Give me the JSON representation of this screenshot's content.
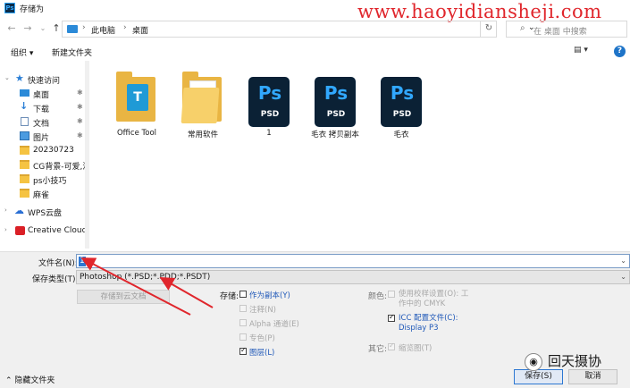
{
  "window": {
    "title": "存储为",
    "app_badge": "Ps"
  },
  "watermark": {
    "url": "www.haoyidiansheji.com",
    "account": "回天摄协"
  },
  "nav": {
    "breadcrumb": [
      "此电脑",
      "桌面"
    ],
    "search_placeholder": "在 桌面 中搜索"
  },
  "toolbar": {
    "organize": "组织 ▾",
    "new_folder": "新建文件夹"
  },
  "sidebar": {
    "items": [
      {
        "label": "快速访问",
        "icon": "star-icon"
      },
      {
        "label": "桌面",
        "icon": "desktop-icon",
        "pinned": true
      },
      {
        "label": "下载",
        "icon": "download-icon",
        "pinned": true
      },
      {
        "label": "文档",
        "icon": "document-icon",
        "pinned": true
      },
      {
        "label": "图片",
        "icon": "picture-icon",
        "pinned": true
      },
      {
        "label": "20230723",
        "icon": "folder-icon"
      },
      {
        "label": "CG背景-可爱,流",
        "icon": "folder-icon"
      },
      {
        "label": "ps小技巧",
        "icon": "folder-icon"
      },
      {
        "label": "麻雀",
        "icon": "folder-icon"
      },
      {
        "label": "WPS云盘",
        "icon": "cloud-icon"
      },
      {
        "label": "Creative Cloud F",
        "icon": "creative-cloud-icon"
      }
    ]
  },
  "files": [
    {
      "name": "Office Tool",
      "type": "folder-app"
    },
    {
      "name": "常用软件",
      "type": "folder"
    },
    {
      "name": "1",
      "type": "psd"
    },
    {
      "name": "毛衣 拷贝副本",
      "type": "psd"
    },
    {
      "name": "毛衣",
      "type": "psd"
    }
  ],
  "psd_icon": {
    "logo": "Ps",
    "ext": "PSD"
  },
  "form": {
    "filename_label": "文件名(N):",
    "filename_value": "1",
    "filetype_label": "保存类型(T):",
    "filetype_value": "Photoshop (*.PSD;*.PDD;*.PSDT)",
    "cloud_button": "存储到云文档",
    "save_label": "存储:",
    "save_options": [
      {
        "label": "作为副本(Y)",
        "checked": false,
        "enabled": true
      },
      {
        "label": "注释(N)",
        "checked": false,
        "enabled": false
      },
      {
        "label": "Alpha 通道(E)",
        "checked": false,
        "enabled": false
      },
      {
        "label": "专色(P)",
        "checked": false,
        "enabled": false
      },
      {
        "label": "图层(L)",
        "checked": true,
        "enabled": true
      }
    ],
    "color_label": "颜色:",
    "proof_setup": "使用校样设置(O): 工作中的 CMYK",
    "icc_profile": "ICC 配置文件(C): Display P3",
    "other_label": "其它:",
    "thumbnail": "缩览图(T)",
    "save_button": "保存(S)",
    "cancel_button": "取消",
    "hide_folders": "隐藏文件夹"
  },
  "colors": {
    "accent": "#2c77d2",
    "ps_blue": "#31a8ff",
    "annotation_red": "#e0262c"
  }
}
